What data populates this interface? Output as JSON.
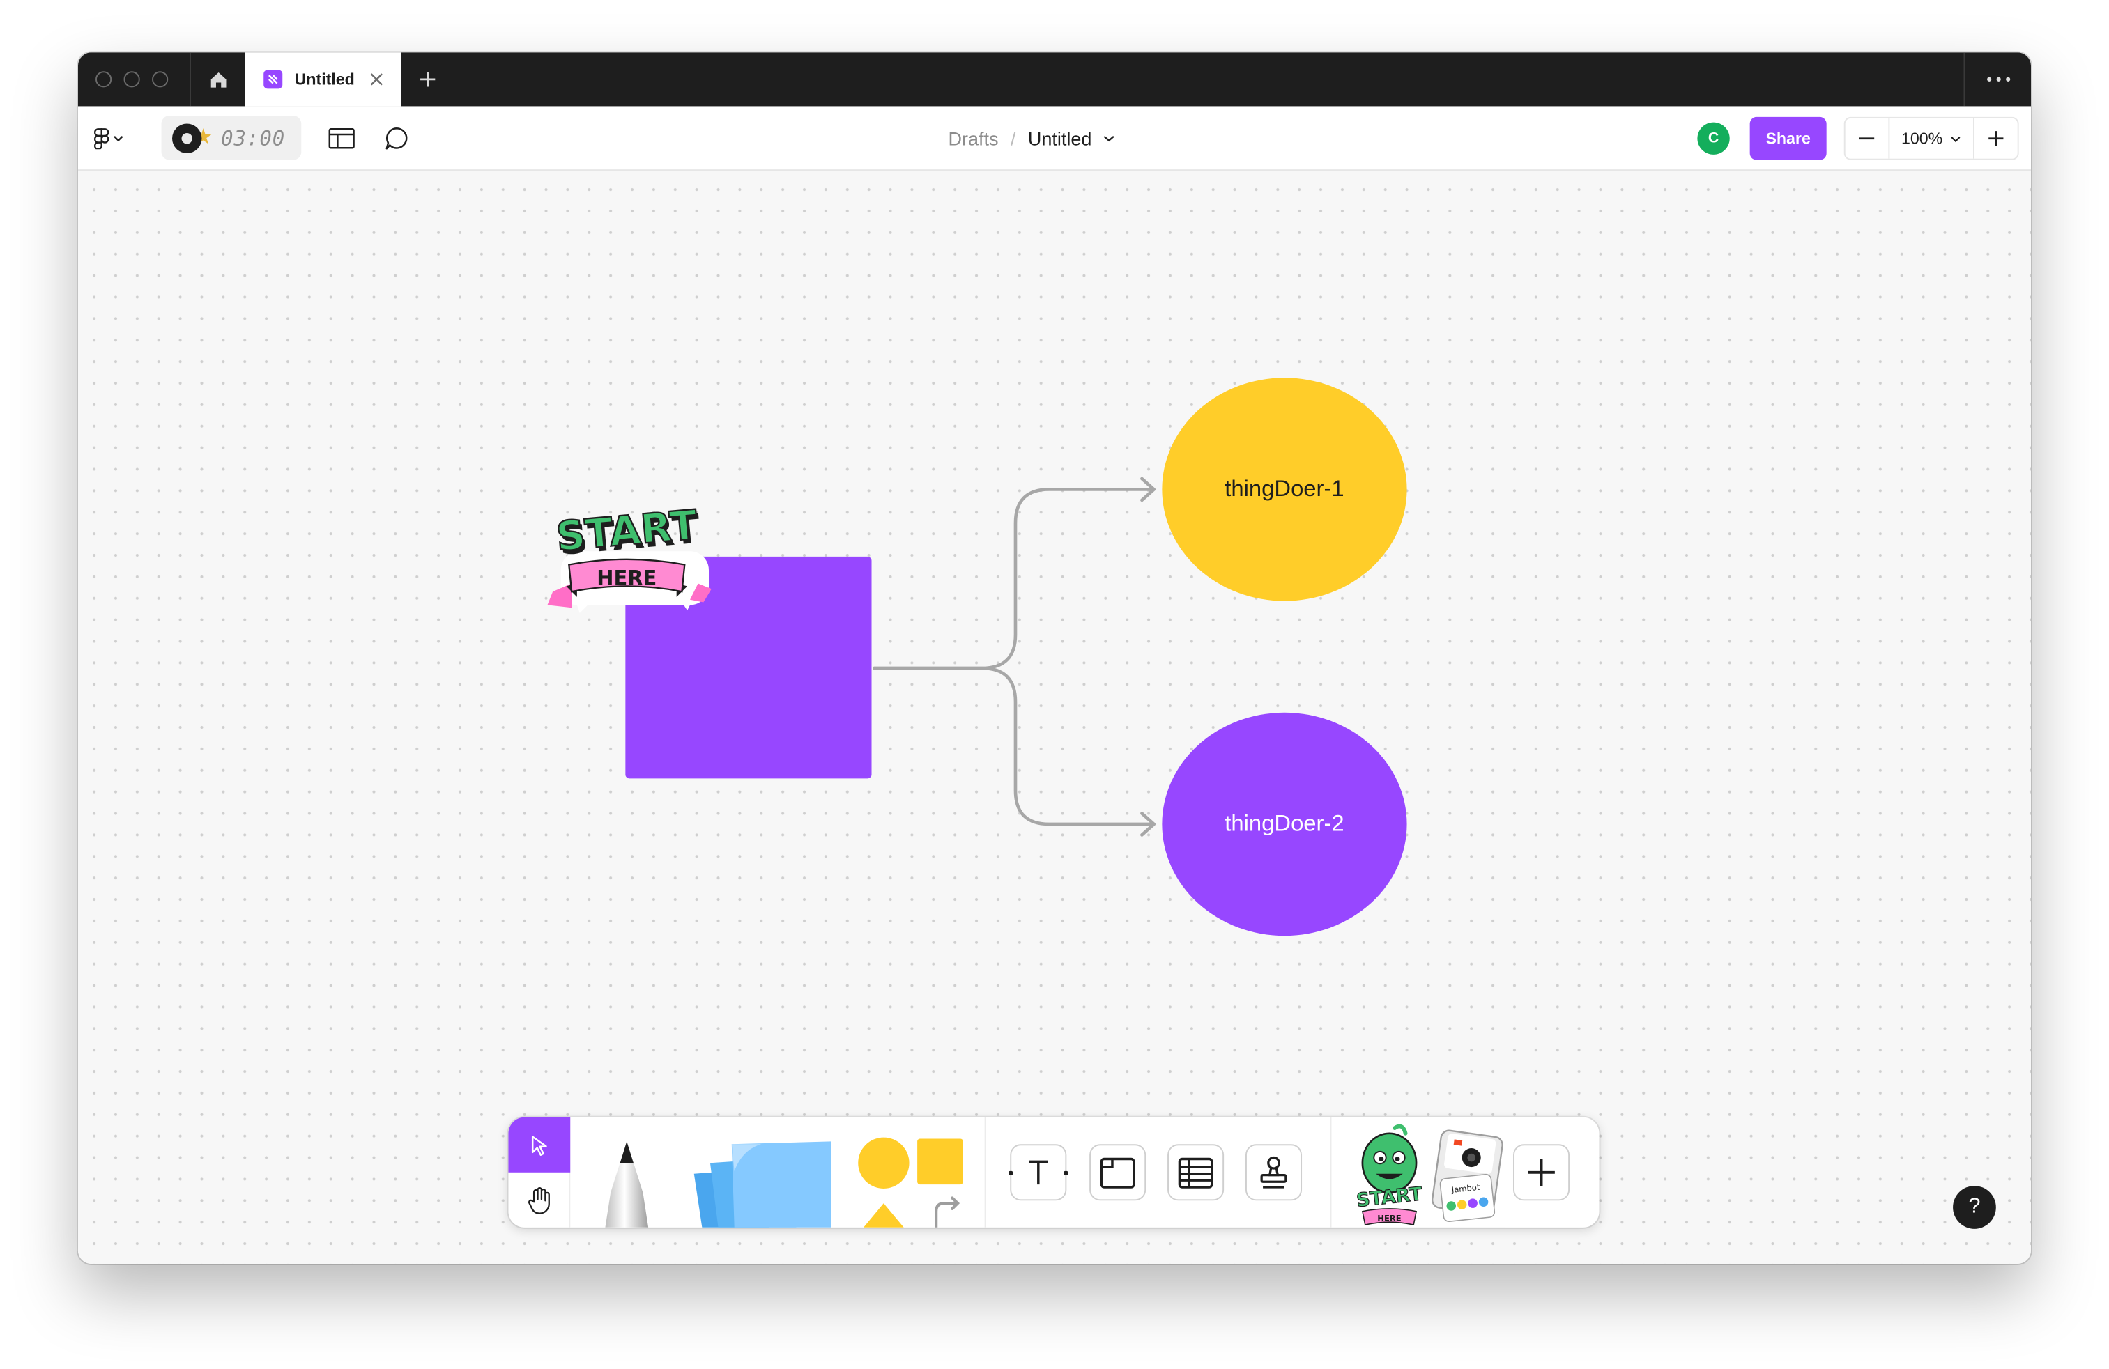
{
  "tabbar": {
    "tab_title": "Untitled",
    "icons": [
      "window-close-dot",
      "window-minimize-dot",
      "window-zoom-dot",
      "home-icon",
      "figjam-file-icon",
      "close-icon",
      "plus-icon",
      "more-icon"
    ]
  },
  "toolbar": {
    "timer_text": "03:00",
    "breadcrumb_parent": "Drafts",
    "breadcrumb_separator": "/",
    "file_title": "Untitled",
    "avatar_initial": "C",
    "share_label": "Share",
    "zoom_level": "100%",
    "icons": [
      "figma-logo-icon",
      "chevron-down-icon",
      "timer-icon",
      "layout-icon",
      "comment-icon",
      "minus-icon",
      "plus-icon"
    ]
  },
  "canvas": {
    "sticker_start_line1": "START",
    "sticker_start_line2": "HERE",
    "node_1_label": "thingDoer-1",
    "node_2_label": "thingDoer-2",
    "help_label": "?"
  },
  "dock": {
    "tools": [
      "select-tool",
      "hand-tool",
      "marker-tool",
      "sticky-note-tool",
      "shapes-tool",
      "text-tool",
      "section-tool",
      "table-tool",
      "stamp-tool",
      "stickers-tool",
      "widgets-tool",
      "more-tools"
    ],
    "sticker_start_line1": "START",
    "sticker_start_line2": "HERE",
    "widget_label": "Jambot"
  },
  "colors": {
    "accent": "#9747ff",
    "yellow": "#ffcd29",
    "avatar_green": "#14ae5c",
    "tabbar_bg": "#1e1e1e",
    "canvas_bg": "#f7f7f7",
    "connector": "#a7a7a7"
  }
}
